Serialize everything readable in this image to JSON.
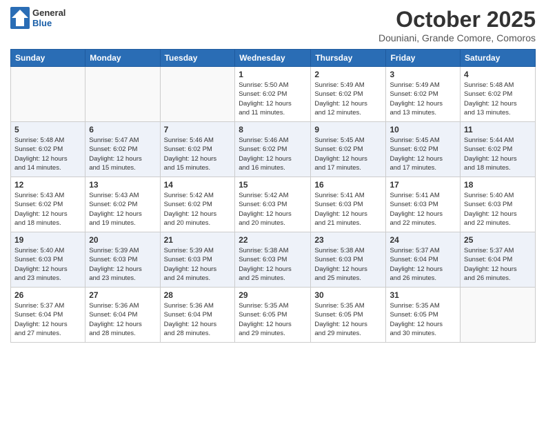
{
  "logo": {
    "general": "General",
    "blue": "Blue"
  },
  "header": {
    "title": "October 2025",
    "location": "Douniani, Grande Comore, Comoros"
  },
  "weekdays": [
    "Sunday",
    "Monday",
    "Tuesday",
    "Wednesday",
    "Thursday",
    "Friday",
    "Saturday"
  ],
  "weeks": [
    [
      {
        "day": "",
        "info": ""
      },
      {
        "day": "",
        "info": ""
      },
      {
        "day": "",
        "info": ""
      },
      {
        "day": "1",
        "info": "Sunrise: 5:50 AM\nSunset: 6:02 PM\nDaylight: 12 hours\nand 11 minutes."
      },
      {
        "day": "2",
        "info": "Sunrise: 5:49 AM\nSunset: 6:02 PM\nDaylight: 12 hours\nand 12 minutes."
      },
      {
        "day": "3",
        "info": "Sunrise: 5:49 AM\nSunset: 6:02 PM\nDaylight: 12 hours\nand 13 minutes."
      },
      {
        "day": "4",
        "info": "Sunrise: 5:48 AM\nSunset: 6:02 PM\nDaylight: 12 hours\nand 13 minutes."
      }
    ],
    [
      {
        "day": "5",
        "info": "Sunrise: 5:48 AM\nSunset: 6:02 PM\nDaylight: 12 hours\nand 14 minutes."
      },
      {
        "day": "6",
        "info": "Sunrise: 5:47 AM\nSunset: 6:02 PM\nDaylight: 12 hours\nand 15 minutes."
      },
      {
        "day": "7",
        "info": "Sunrise: 5:46 AM\nSunset: 6:02 PM\nDaylight: 12 hours\nand 15 minutes."
      },
      {
        "day": "8",
        "info": "Sunrise: 5:46 AM\nSunset: 6:02 PM\nDaylight: 12 hours\nand 16 minutes."
      },
      {
        "day": "9",
        "info": "Sunrise: 5:45 AM\nSunset: 6:02 PM\nDaylight: 12 hours\nand 17 minutes."
      },
      {
        "day": "10",
        "info": "Sunrise: 5:45 AM\nSunset: 6:02 PM\nDaylight: 12 hours\nand 17 minutes."
      },
      {
        "day": "11",
        "info": "Sunrise: 5:44 AM\nSunset: 6:02 PM\nDaylight: 12 hours\nand 18 minutes."
      }
    ],
    [
      {
        "day": "12",
        "info": "Sunrise: 5:43 AM\nSunset: 6:02 PM\nDaylight: 12 hours\nand 18 minutes."
      },
      {
        "day": "13",
        "info": "Sunrise: 5:43 AM\nSunset: 6:02 PM\nDaylight: 12 hours\nand 19 minutes."
      },
      {
        "day": "14",
        "info": "Sunrise: 5:42 AM\nSunset: 6:02 PM\nDaylight: 12 hours\nand 20 minutes."
      },
      {
        "day": "15",
        "info": "Sunrise: 5:42 AM\nSunset: 6:03 PM\nDaylight: 12 hours\nand 20 minutes."
      },
      {
        "day": "16",
        "info": "Sunrise: 5:41 AM\nSunset: 6:03 PM\nDaylight: 12 hours\nand 21 minutes."
      },
      {
        "day": "17",
        "info": "Sunrise: 5:41 AM\nSunset: 6:03 PM\nDaylight: 12 hours\nand 22 minutes."
      },
      {
        "day": "18",
        "info": "Sunrise: 5:40 AM\nSunset: 6:03 PM\nDaylight: 12 hours\nand 22 minutes."
      }
    ],
    [
      {
        "day": "19",
        "info": "Sunrise: 5:40 AM\nSunset: 6:03 PM\nDaylight: 12 hours\nand 23 minutes."
      },
      {
        "day": "20",
        "info": "Sunrise: 5:39 AM\nSunset: 6:03 PM\nDaylight: 12 hours\nand 23 minutes."
      },
      {
        "day": "21",
        "info": "Sunrise: 5:39 AM\nSunset: 6:03 PM\nDaylight: 12 hours\nand 24 minutes."
      },
      {
        "day": "22",
        "info": "Sunrise: 5:38 AM\nSunset: 6:03 PM\nDaylight: 12 hours\nand 25 minutes."
      },
      {
        "day": "23",
        "info": "Sunrise: 5:38 AM\nSunset: 6:03 PM\nDaylight: 12 hours\nand 25 minutes."
      },
      {
        "day": "24",
        "info": "Sunrise: 5:37 AM\nSunset: 6:04 PM\nDaylight: 12 hours\nand 26 minutes."
      },
      {
        "day": "25",
        "info": "Sunrise: 5:37 AM\nSunset: 6:04 PM\nDaylight: 12 hours\nand 26 minutes."
      }
    ],
    [
      {
        "day": "26",
        "info": "Sunrise: 5:37 AM\nSunset: 6:04 PM\nDaylight: 12 hours\nand 27 minutes."
      },
      {
        "day": "27",
        "info": "Sunrise: 5:36 AM\nSunset: 6:04 PM\nDaylight: 12 hours\nand 28 minutes."
      },
      {
        "day": "28",
        "info": "Sunrise: 5:36 AM\nSunset: 6:04 PM\nDaylight: 12 hours\nand 28 minutes."
      },
      {
        "day": "29",
        "info": "Sunrise: 5:35 AM\nSunset: 6:05 PM\nDaylight: 12 hours\nand 29 minutes."
      },
      {
        "day": "30",
        "info": "Sunrise: 5:35 AM\nSunset: 6:05 PM\nDaylight: 12 hours\nand 29 minutes."
      },
      {
        "day": "31",
        "info": "Sunrise: 5:35 AM\nSunset: 6:05 PM\nDaylight: 12 hours\nand 30 minutes."
      },
      {
        "day": "",
        "info": ""
      }
    ]
  ]
}
